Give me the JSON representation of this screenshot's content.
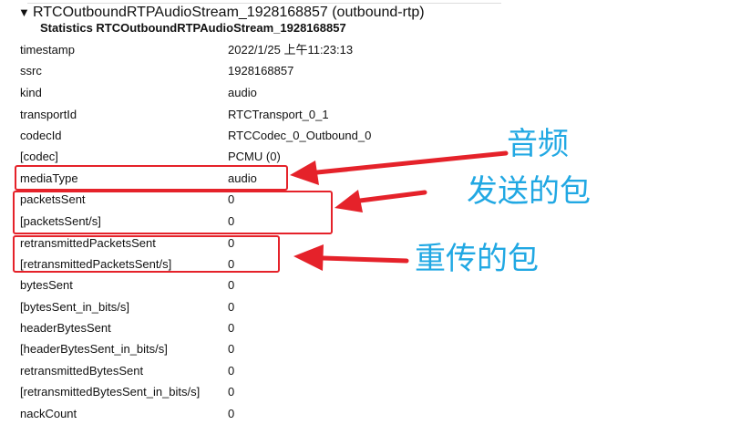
{
  "header": {
    "toggle": "▼",
    "title": "RTCOutboundRTPAudioStream_1928168857 (outbound-rtp)",
    "subtitle": "Statistics RTCOutboundRTPAudioStream_1928168857"
  },
  "rows": [
    {
      "key": "timestamp",
      "value": "2022/1/25 上午11:23:13"
    },
    {
      "key": "ssrc",
      "value": "1928168857"
    },
    {
      "key": "kind",
      "value": "audio"
    },
    {
      "key": "transportId",
      "value": "RTCTransport_0_1"
    },
    {
      "key": "codecId",
      "value": "RTCCodec_0_Outbound_0"
    },
    {
      "key": "[codec]",
      "value": "PCMU (0)"
    },
    {
      "key": "mediaType",
      "value": "audio"
    },
    {
      "key": "packetsSent",
      "value": "0"
    },
    {
      "key": "[packetsSent/s]",
      "value": "0"
    },
    {
      "key": "retransmittedPacketsSent",
      "value": "0"
    },
    {
      "key": "[retransmittedPacketsSent/s]",
      "value": "0"
    },
    {
      "key": "bytesSent",
      "value": "0"
    },
    {
      "key": "[bytesSent_in_bits/s]",
      "value": "0"
    },
    {
      "key": "headerBytesSent",
      "value": "0"
    },
    {
      "key": "[headerBytesSent_in_bits/s]",
      "value": "0"
    },
    {
      "key": "retransmittedBytesSent",
      "value": "0"
    },
    {
      "key": "[retransmittedBytesSent_in_bits/s]",
      "value": "0"
    },
    {
      "key": "nackCount",
      "value": "0"
    }
  ],
  "annotations": {
    "audio": "音频",
    "packets_sent": "发送的包",
    "retransmitted": "重传的包"
  },
  "colors": {
    "annotation_box": "#e5222a",
    "annotation_text": "#21a8e3"
  }
}
